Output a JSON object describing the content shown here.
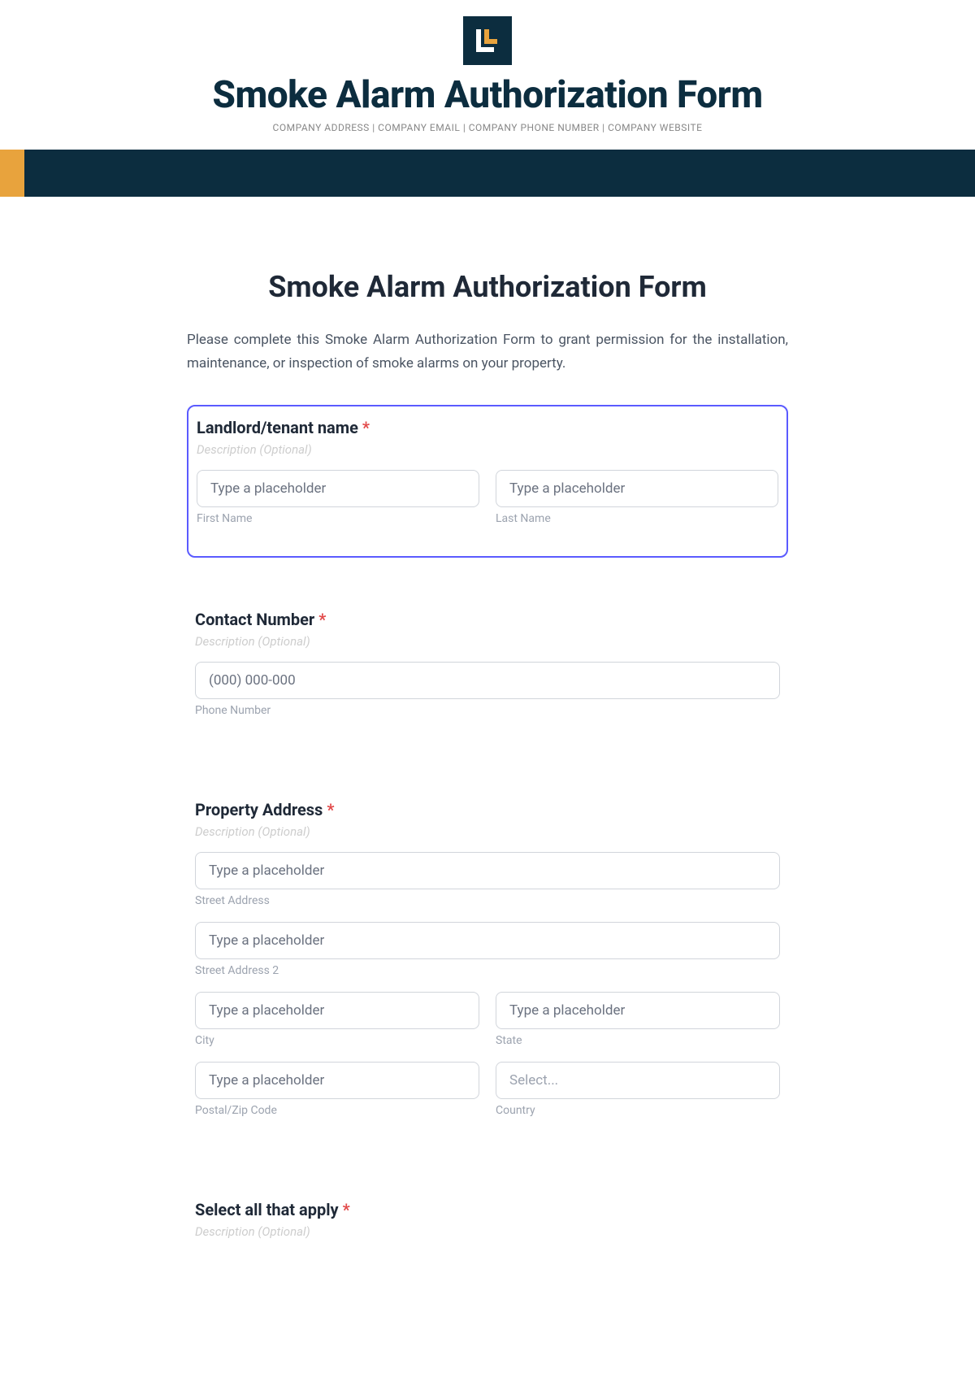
{
  "header": {
    "title": "Smoke Alarm Authorization Form",
    "subtitle": "COMPANY ADDRESS | COMPANY EMAIL | COMPANY PHONE NUMBER | COMPANY WEBSITE"
  },
  "page": {
    "title": "Smoke Alarm Authorization Form",
    "intro": "Please complete this Smoke Alarm Authorization Form to grant permission for the installation, maintenance, or inspection of smoke alarms on your property."
  },
  "sections": {
    "name": {
      "title": "Landlord/tenant name",
      "required": "*",
      "desc": "Description (Optional)",
      "first_placeholder": "Type a placeholder",
      "first_label": "First Name",
      "last_placeholder": "Type a placeholder",
      "last_label": "Last Name"
    },
    "contact": {
      "title": "Contact Number",
      "required": "*",
      "desc": "Description (Optional)",
      "phone_placeholder": "(000) 000-000",
      "phone_label": "Phone Number"
    },
    "address": {
      "title": "Property Address",
      "required": "*",
      "desc": "Description (Optional)",
      "street_placeholder": "Type a placeholder",
      "street_label": "Street Address",
      "street2_placeholder": "Type a placeholder",
      "street2_label": "Street Address 2",
      "city_placeholder": "Type a placeholder",
      "city_label": "City",
      "state_placeholder": "Type a placeholder",
      "state_label": "State",
      "postal_placeholder": "Type a placeholder",
      "postal_label": "Postal/Zip Code",
      "country_placeholder": "Select...",
      "country_label": "Country"
    },
    "apply": {
      "title": "Select all that apply",
      "required": "*",
      "desc": "Description (Optional)"
    }
  }
}
